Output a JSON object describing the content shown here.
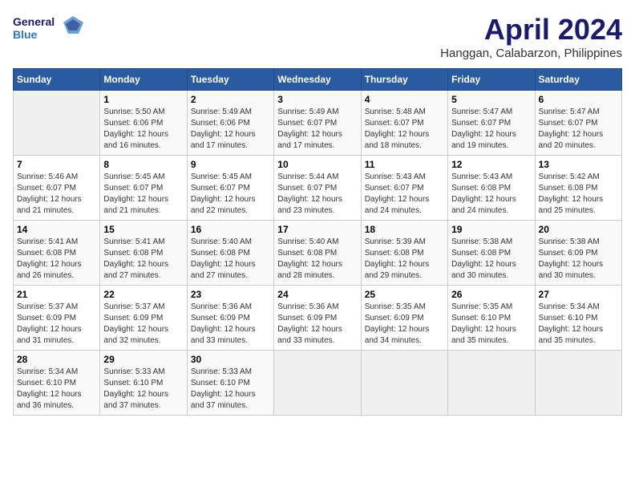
{
  "header": {
    "logo_line1": "General",
    "logo_line2": "Blue",
    "month": "April 2024",
    "location": "Hanggan, Calabarzon, Philippines"
  },
  "days_of_week": [
    "Sunday",
    "Monday",
    "Tuesday",
    "Wednesday",
    "Thursday",
    "Friday",
    "Saturday"
  ],
  "weeks": [
    [
      {
        "day": "",
        "sunrise": "",
        "sunset": "",
        "daylight": "",
        "empty": true
      },
      {
        "day": "1",
        "sunrise": "Sunrise: 5:50 AM",
        "sunset": "Sunset: 6:06 PM",
        "daylight": "Daylight: 12 hours and 16 minutes."
      },
      {
        "day": "2",
        "sunrise": "Sunrise: 5:49 AM",
        "sunset": "Sunset: 6:06 PM",
        "daylight": "Daylight: 12 hours and 17 minutes."
      },
      {
        "day": "3",
        "sunrise": "Sunrise: 5:49 AM",
        "sunset": "Sunset: 6:07 PM",
        "daylight": "Daylight: 12 hours and 17 minutes."
      },
      {
        "day": "4",
        "sunrise": "Sunrise: 5:48 AM",
        "sunset": "Sunset: 6:07 PM",
        "daylight": "Daylight: 12 hours and 18 minutes."
      },
      {
        "day": "5",
        "sunrise": "Sunrise: 5:47 AM",
        "sunset": "Sunset: 6:07 PM",
        "daylight": "Daylight: 12 hours and 19 minutes."
      },
      {
        "day": "6",
        "sunrise": "Sunrise: 5:47 AM",
        "sunset": "Sunset: 6:07 PM",
        "daylight": "Daylight: 12 hours and 20 minutes."
      }
    ],
    [
      {
        "day": "7",
        "sunrise": "Sunrise: 5:46 AM",
        "sunset": "Sunset: 6:07 PM",
        "daylight": "Daylight: 12 hours and 21 minutes."
      },
      {
        "day": "8",
        "sunrise": "Sunrise: 5:45 AM",
        "sunset": "Sunset: 6:07 PM",
        "daylight": "Daylight: 12 hours and 21 minutes."
      },
      {
        "day": "9",
        "sunrise": "Sunrise: 5:45 AM",
        "sunset": "Sunset: 6:07 PM",
        "daylight": "Daylight: 12 hours and 22 minutes."
      },
      {
        "day": "10",
        "sunrise": "Sunrise: 5:44 AM",
        "sunset": "Sunset: 6:07 PM",
        "daylight": "Daylight: 12 hours and 23 minutes."
      },
      {
        "day": "11",
        "sunrise": "Sunrise: 5:43 AM",
        "sunset": "Sunset: 6:07 PM",
        "daylight": "Daylight: 12 hours and 24 minutes."
      },
      {
        "day": "12",
        "sunrise": "Sunrise: 5:43 AM",
        "sunset": "Sunset: 6:08 PM",
        "daylight": "Daylight: 12 hours and 24 minutes."
      },
      {
        "day": "13",
        "sunrise": "Sunrise: 5:42 AM",
        "sunset": "Sunset: 6:08 PM",
        "daylight": "Daylight: 12 hours and 25 minutes."
      }
    ],
    [
      {
        "day": "14",
        "sunrise": "Sunrise: 5:41 AM",
        "sunset": "Sunset: 6:08 PM",
        "daylight": "Daylight: 12 hours and 26 minutes."
      },
      {
        "day": "15",
        "sunrise": "Sunrise: 5:41 AM",
        "sunset": "Sunset: 6:08 PM",
        "daylight": "Daylight: 12 hours and 27 minutes."
      },
      {
        "day": "16",
        "sunrise": "Sunrise: 5:40 AM",
        "sunset": "Sunset: 6:08 PM",
        "daylight": "Daylight: 12 hours and 27 minutes."
      },
      {
        "day": "17",
        "sunrise": "Sunrise: 5:40 AM",
        "sunset": "Sunset: 6:08 PM",
        "daylight": "Daylight: 12 hours and 28 minutes."
      },
      {
        "day": "18",
        "sunrise": "Sunrise: 5:39 AM",
        "sunset": "Sunset: 6:08 PM",
        "daylight": "Daylight: 12 hours and 29 minutes."
      },
      {
        "day": "19",
        "sunrise": "Sunrise: 5:38 AM",
        "sunset": "Sunset: 6:08 PM",
        "daylight": "Daylight: 12 hours and 30 minutes."
      },
      {
        "day": "20",
        "sunrise": "Sunrise: 5:38 AM",
        "sunset": "Sunset: 6:09 PM",
        "daylight": "Daylight: 12 hours and 30 minutes."
      }
    ],
    [
      {
        "day": "21",
        "sunrise": "Sunrise: 5:37 AM",
        "sunset": "Sunset: 6:09 PM",
        "daylight": "Daylight: 12 hours and 31 minutes."
      },
      {
        "day": "22",
        "sunrise": "Sunrise: 5:37 AM",
        "sunset": "Sunset: 6:09 PM",
        "daylight": "Daylight: 12 hours and 32 minutes."
      },
      {
        "day": "23",
        "sunrise": "Sunrise: 5:36 AM",
        "sunset": "Sunset: 6:09 PM",
        "daylight": "Daylight: 12 hours and 33 minutes."
      },
      {
        "day": "24",
        "sunrise": "Sunrise: 5:36 AM",
        "sunset": "Sunset: 6:09 PM",
        "daylight": "Daylight: 12 hours and 33 minutes."
      },
      {
        "day": "25",
        "sunrise": "Sunrise: 5:35 AM",
        "sunset": "Sunset: 6:09 PM",
        "daylight": "Daylight: 12 hours and 34 minutes."
      },
      {
        "day": "26",
        "sunrise": "Sunrise: 5:35 AM",
        "sunset": "Sunset: 6:10 PM",
        "daylight": "Daylight: 12 hours and 35 minutes."
      },
      {
        "day": "27",
        "sunrise": "Sunrise: 5:34 AM",
        "sunset": "Sunset: 6:10 PM",
        "daylight": "Daylight: 12 hours and 35 minutes."
      }
    ],
    [
      {
        "day": "28",
        "sunrise": "Sunrise: 5:34 AM",
        "sunset": "Sunset: 6:10 PM",
        "daylight": "Daylight: 12 hours and 36 minutes."
      },
      {
        "day": "29",
        "sunrise": "Sunrise: 5:33 AM",
        "sunset": "Sunset: 6:10 PM",
        "daylight": "Daylight: 12 hours and 37 minutes."
      },
      {
        "day": "30",
        "sunrise": "Sunrise: 5:33 AM",
        "sunset": "Sunset: 6:10 PM",
        "daylight": "Daylight: 12 hours and 37 minutes."
      },
      {
        "day": "",
        "sunrise": "",
        "sunset": "",
        "daylight": "",
        "empty": true
      },
      {
        "day": "",
        "sunrise": "",
        "sunset": "",
        "daylight": "",
        "empty": true
      },
      {
        "day": "",
        "sunrise": "",
        "sunset": "",
        "daylight": "",
        "empty": true
      },
      {
        "day": "",
        "sunrise": "",
        "sunset": "",
        "daylight": "",
        "empty": true
      }
    ]
  ]
}
